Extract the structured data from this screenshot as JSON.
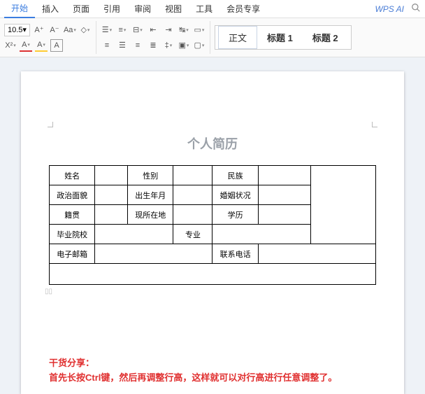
{
  "menu": {
    "items": [
      "开始",
      "插入",
      "页面",
      "引用",
      "审阅",
      "视图",
      "工具",
      "会员专享"
    ],
    "active_index": 0,
    "wps_ai": "WPS AI"
  },
  "toolbar": {
    "font_size": "10.5",
    "color_mark_A": "A",
    "highlight_mark": "A",
    "style_normal": "正文",
    "style_h1": "标题 1",
    "style_h2": "标题 2"
  },
  "document": {
    "title": "个人简历",
    "labels": {
      "name": "姓名",
      "gender": "性别",
      "ethnicity": "民族",
      "politics": "政治面貌",
      "birth": "出生年月",
      "marriage": "婚姻状况",
      "hometown": "籍贯",
      "location": "现所在地",
      "education": "学历",
      "school": "毕业院校",
      "major": "专业",
      "email": "电子邮箱",
      "phone": "联系电话"
    },
    "tip_title": "干货分享：",
    "tip_body": "首先长按Ctrl键，然后再调整行高，这样就可以对行高进行任意调整了。"
  }
}
